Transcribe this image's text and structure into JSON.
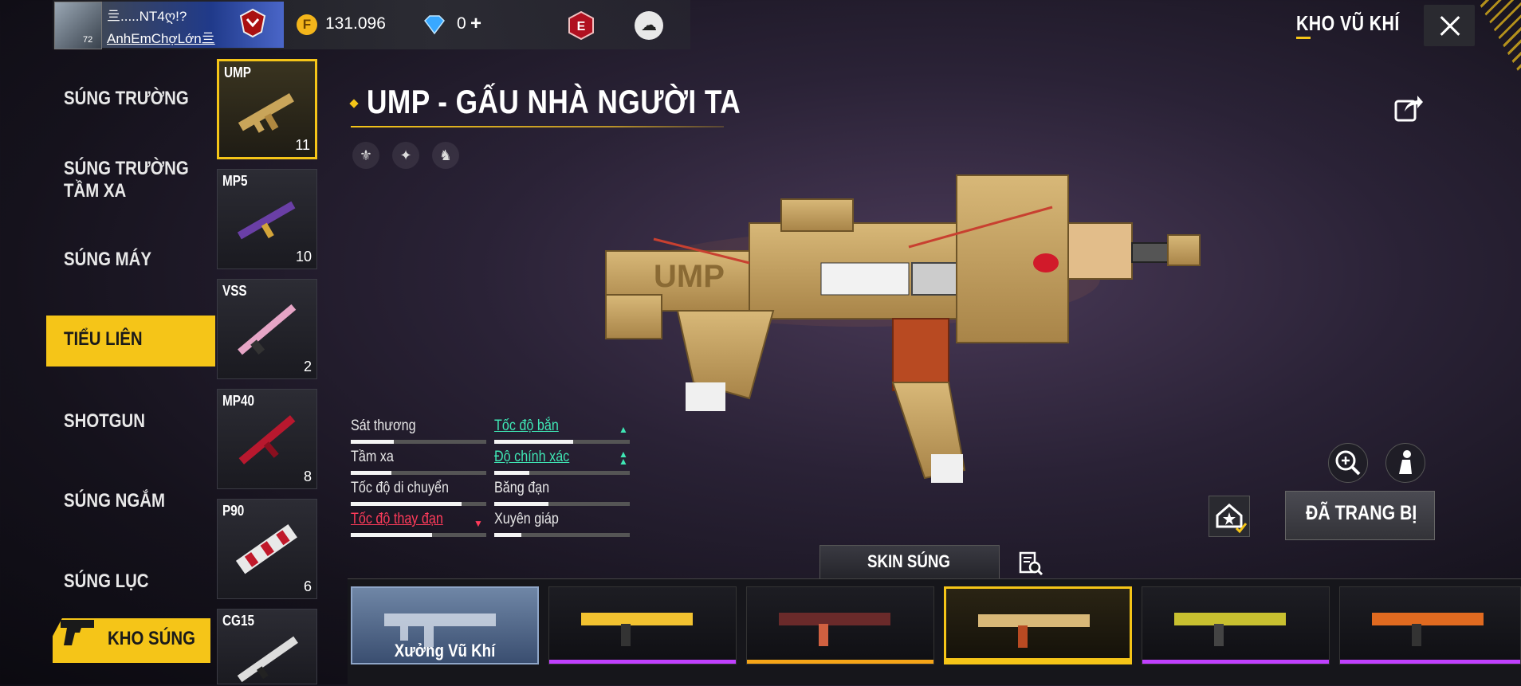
{
  "header": {
    "player_name_top": "亖.....NT4ღ!?",
    "player_name": "AnhEmChợLớn亖",
    "player_level": "72",
    "gold": "131.096",
    "diamonds": "0",
    "diamond_plus": "+",
    "elite_letter": "E",
    "page_title": "KHO VŨ KHÍ"
  },
  "categories": [
    {
      "label": "SÚNG TRƯỜNG"
    },
    {
      "label": "SÚNG TRƯỜNG\nTẦM XA"
    },
    {
      "label": "SÚNG MÁY"
    },
    {
      "label": "TIỂU LIÊN",
      "active": true
    },
    {
      "label": "SHOTGUN"
    },
    {
      "label": "SÚNG NGẮM"
    },
    {
      "label": "SÚNG LỤC"
    }
  ],
  "armory_button": "KHO SÚNG",
  "weapons": [
    {
      "name": "UMP",
      "count": "11",
      "active": true
    },
    {
      "name": "MP5",
      "count": "10"
    },
    {
      "name": "VSS",
      "count": "2"
    },
    {
      "name": "MP40",
      "count": "8"
    },
    {
      "name": "P90",
      "count": "6"
    },
    {
      "name": "CG15",
      "count": ""
    }
  ],
  "selected": {
    "title": "UMP - GẤU NHÀ NGƯỜI TA",
    "stats": [
      {
        "label": "Sát thương",
        "level": 0.32,
        "trend": "none"
      },
      {
        "label": "Tầm xa",
        "level": 0.3,
        "trend": "none"
      },
      {
        "label": "Tốc độ di chuyển",
        "level": 0.82,
        "trend": "none"
      },
      {
        "label": "Tốc độ thay đạn",
        "level": 0.6,
        "trend": "down"
      },
      {
        "label": "Tốc độ bắn",
        "level": 0.58,
        "trend": "up"
      },
      {
        "label": "Độ chính xác",
        "level": 0.26,
        "trend": "up2"
      },
      {
        "label": "Băng đạn",
        "level": 0.4,
        "trend": "none"
      },
      {
        "label": "Xuyên giáp",
        "level": 0.2,
        "trend": "none"
      }
    ]
  },
  "equip_button": "ĐÃ TRANG BỊ",
  "skin_tab": "SKIN SÚNG",
  "skins": [
    {
      "label": "Xưởng Vũ Khí",
      "rarity_color": ""
    },
    {
      "label": "",
      "rarity_color": "#c040ff"
    },
    {
      "label": "",
      "rarity_color": "#f5a518"
    },
    {
      "label": "",
      "rarity_color": "#f5c518",
      "selected": true
    },
    {
      "label": "",
      "rarity_color": "#c040ff"
    },
    {
      "label": "",
      "rarity_color": "#c040ff"
    }
  ],
  "colors": {
    "accent": "#f5c518",
    "stat_up": "#3fe6b4",
    "stat_down": "#ff3b5a"
  }
}
